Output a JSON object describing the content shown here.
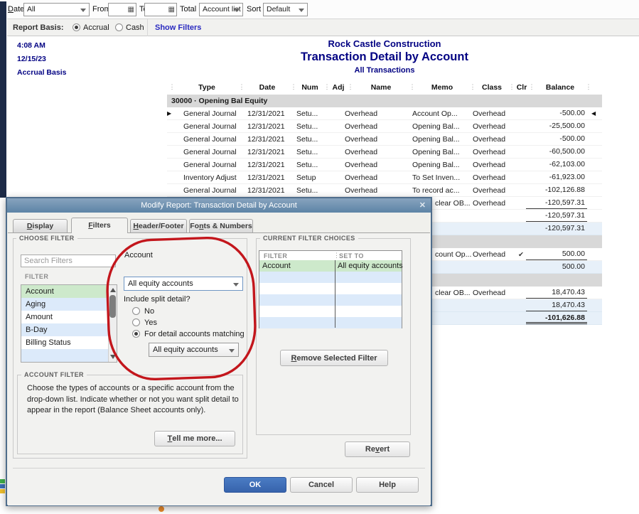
{
  "toolbar": {
    "dates_label": "&Dates",
    "dates_value": "All",
    "from_label": "From",
    "to_label": "To",
    "total_by_label": "Total By",
    "total_by_value": "Account list",
    "sort_by_label": "Sort By",
    "sort_by_value": "Default"
  },
  "basis_bar": {
    "label": "Report Basis:",
    "accrual": "Accrual",
    "cash": "Cash",
    "selected": "Accrual",
    "show_filters": "Show Filters"
  },
  "report": {
    "time": "4:08 AM",
    "date": "12/15/23",
    "basis": "Accrual Basis",
    "company": "Rock Castle Construction",
    "title": "Transaction Detail by Account",
    "subtitle": "All Transactions",
    "columns": [
      "Type",
      "Date",
      "Num",
      "Adj",
      "Name",
      "Memo",
      "Class",
      "Clr",
      "Balance"
    ],
    "rows": [
      {
        "kind": "group",
        "label": "30000 · Opening Bal Equity"
      },
      {
        "kind": "detail",
        "pointer": true,
        "marker": true,
        "type": "General Journal",
        "date": "12/31/2021",
        "num": "Setu...",
        "name": "Overhead",
        "memo": "Account Op...",
        "cls": "Overhead",
        "bal": "-500.00"
      },
      {
        "kind": "detail",
        "type": "General Journal",
        "date": "12/31/2021",
        "num": "Setu...",
        "name": "Overhead",
        "memo": "Opening Bal...",
        "cls": "Overhead",
        "bal": "-25,500.00"
      },
      {
        "kind": "detail",
        "type": "General Journal",
        "date": "12/31/2021",
        "num": "Setu...",
        "name": "Overhead",
        "memo": "Opening Bal...",
        "cls": "Overhead",
        "bal": "-500.00"
      },
      {
        "kind": "detail",
        "type": "General Journal",
        "date": "12/31/2021",
        "num": "Setu...",
        "name": "Overhead",
        "memo": "Opening Bal...",
        "cls": "Overhead",
        "bal": "-60,500.00"
      },
      {
        "kind": "detail",
        "type": "General Journal",
        "date": "12/31/2021",
        "num": "Setu...",
        "name": "Overhead",
        "memo": "Opening Bal...",
        "cls": "Overhead",
        "bal": "-62,103.00"
      },
      {
        "kind": "detail",
        "type": "Inventory Adjust",
        "date": "12/31/2021",
        "num": "Setup",
        "name": "Overhead",
        "memo": "To Set Inven...",
        "cls": "Overhead",
        "bal": "-61,923.00"
      },
      {
        "kind": "detail",
        "type": "General Journal",
        "date": "12/31/2021",
        "num": "Setu...",
        "name": "Overhead",
        "memo": "To record ac...",
        "cls": "Overhead",
        "bal": "-102,126.88"
      },
      {
        "kind": "detail",
        "peek": true,
        "memo": "clear OB...",
        "cls": "Overhead",
        "bal": "-120,597.31",
        "rule": true
      },
      {
        "kind": "sub",
        "bal": "-120,597.31",
        "rule": true
      },
      {
        "kind": "sub",
        "shade": "blue",
        "bal": "-120,597.31"
      },
      {
        "kind": "band"
      },
      {
        "kind": "detail",
        "peek": true,
        "memo": "count Op...",
        "cls": "Overhead",
        "clr": true,
        "bal": "500.00",
        "rule": true
      },
      {
        "kind": "sub",
        "shade": "blue",
        "bal": "500.00"
      },
      {
        "kind": "band"
      },
      {
        "kind": "detail",
        "peek": true,
        "memo": "clear OB...",
        "cls": "Overhead",
        "bal": "18,470.43",
        "rule": true
      },
      {
        "kind": "sub",
        "shade": "blue",
        "bal": "18,470.43",
        "rule": true
      },
      {
        "kind": "sub",
        "shade": "blue",
        "bold": true,
        "dbl": true,
        "bal": "-101,626.88"
      }
    ]
  },
  "dialog": {
    "title": "Modify Report: Transaction Detail by Account",
    "close_glyph": "✕",
    "tabs": [
      "&Display",
      "&Filters",
      "&Header/Footer",
      "Fo&nts & Numbers"
    ],
    "active_tab": "Filters",
    "choose_filter": {
      "label": "CHOOSE FILTER",
      "search_placeholder": "Search Filters",
      "list_label": "FILTER",
      "filters": [
        "Account",
        "Aging",
        "Amount",
        "B-Day",
        "Billing Status"
      ],
      "selected_filter": "Account"
    },
    "account_panel": {
      "label": "Account",
      "dropdown_value": "All equity accounts",
      "split_question": "Include split detail?",
      "options": [
        "No",
        "Yes",
        "For detail accounts matching"
      ],
      "selected_option": "For detail accounts matching",
      "matching_value": "All equity accounts"
    },
    "current_choices": {
      "label": "CURRENT FILTER CHOICES",
      "col_filter": "FILTER",
      "col_set_to": "SET TO",
      "rows": [
        {
          "filter": "Account",
          "set_to": "All equity accounts"
        }
      ],
      "remove_button": "&Remove Selected Filter"
    },
    "account_filter": {
      "label": "ACCOUNT FILTER",
      "description": "Choose the types of accounts or a specific account from the drop-down list. Indicate whether or not you want split detail to appear in the report (Balance Sheet accounts only).",
      "tell_me_more": "&Tell me more..."
    },
    "revert": "Re&vert",
    "ok": "OK",
    "cancel": "Cancel",
    "help": "Help"
  },
  "annotation": {
    "color": "#c3161c"
  }
}
